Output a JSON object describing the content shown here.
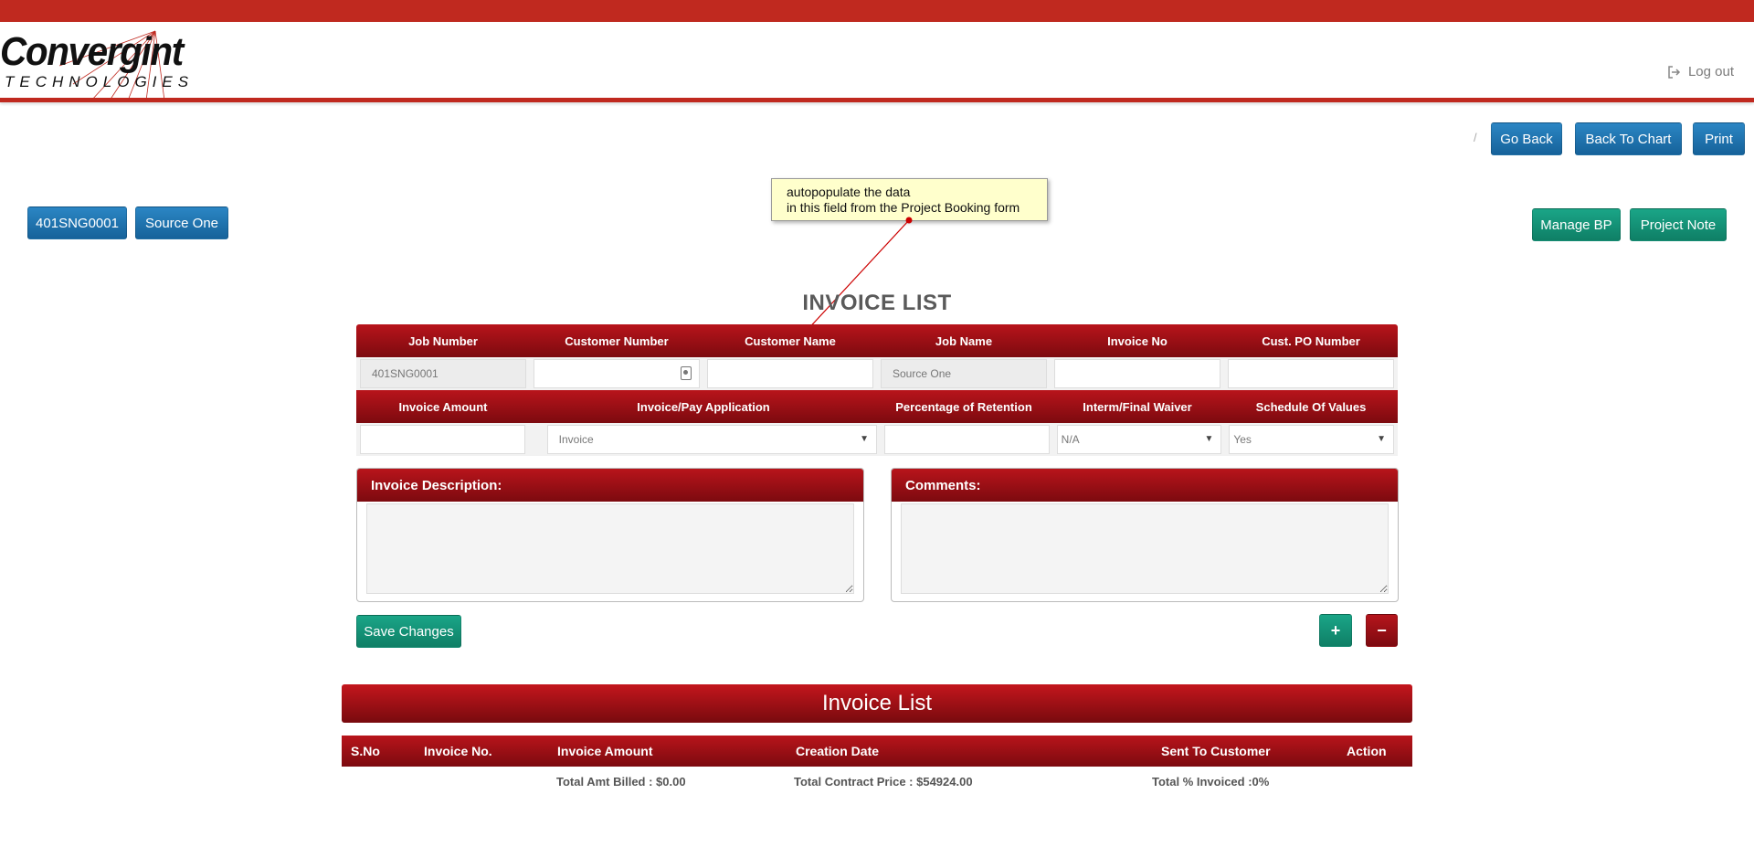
{
  "header": {
    "logo_main": "Convergint",
    "logo_sub": "TECHNOLOGIES",
    "logout_label": "Log out"
  },
  "nav": {
    "separator": "/",
    "go_back": "Go Back",
    "back_to_chart": "Back To Chart",
    "print": "Print"
  },
  "job_badges": {
    "job_number": "401SNG0001",
    "job_name": "Source One"
  },
  "actions": {
    "manage_bp": "Manage BP",
    "project_note": "Project Note"
  },
  "annotation": {
    "line1": "autopopulate the data",
    "line2": "in this field from the Project Booking form"
  },
  "form": {
    "title": "INVOICE LIST",
    "row1_headers": [
      "Job Number",
      "Customer Number",
      "Customer Name",
      "Job Name",
      "Invoice No",
      "Cust. PO Number"
    ],
    "row1_values": [
      "401SNG0001",
      "",
      "",
      "Source One",
      "",
      ""
    ],
    "row2_headers": [
      "Invoice Amount",
      "Invoice/Pay Application",
      "Percentage of Retention",
      "Interm/Final Waiver",
      "Schedule Of Values"
    ],
    "row2_values": {
      "invoice_amount": "",
      "pay_application": "Invoice",
      "retention": "",
      "waiver": "N/A",
      "schedule_of_values": "Yes"
    },
    "invoice_description_label": "Invoice Description:",
    "comments_label": "Comments:",
    "save_label": "Save Changes",
    "add_label": "+",
    "remove_label": "−"
  },
  "invoice_list": {
    "title": "Invoice List",
    "columns": [
      "S.No",
      "Invoice No.",
      "Invoice Amount",
      "Creation Date",
      "Sent To Customer",
      "Action"
    ],
    "total_billed": "Total Amt Billed : $0.00",
    "total_contract": "Total Contract Price : $54924.00",
    "total_invoiced": "Total % Invoiced :0%"
  },
  "colors": {
    "brand_red": "#c0291f",
    "header_red": "#9a0f16",
    "button_blue": "#1d6fa8",
    "button_green": "#139377",
    "tooltip_yellow": "#ffffcc"
  }
}
